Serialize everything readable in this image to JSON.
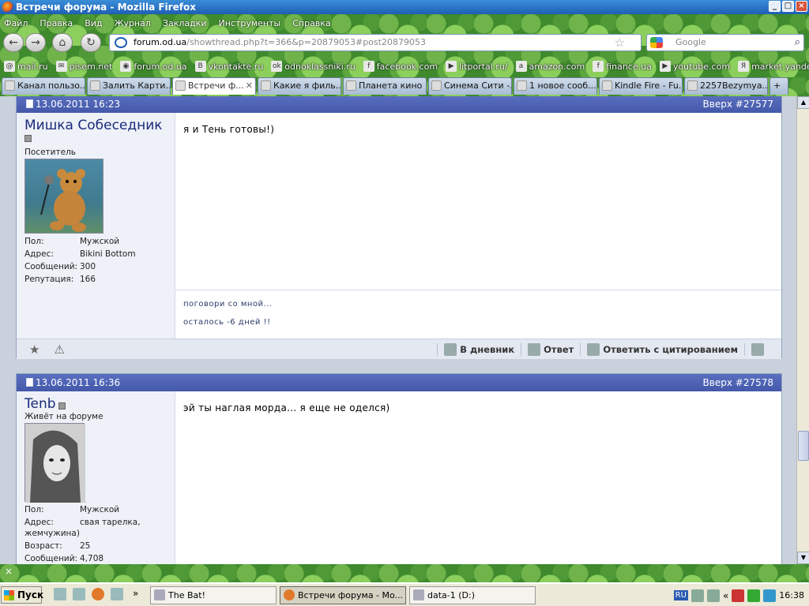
{
  "window": {
    "title": "Встречи форума - Mozilla Firefox"
  },
  "menu": [
    "Файл",
    "Правка",
    "Вид",
    "Журнал",
    "Закладки",
    "Инструменты",
    "Справка"
  ],
  "address": {
    "domain": "forum.od.ua",
    "path": "/showthread.php?t=366&p=20879053#post20879053"
  },
  "search": {
    "placeholder": "Google"
  },
  "bookmarks": [
    {
      "label": "mail.ru",
      "icon": "@"
    },
    {
      "label": "pisem.net",
      "icon": "✉"
    },
    {
      "label": "forum.od.ua",
      "icon": "◉"
    },
    {
      "label": "vkontakte.ru",
      "icon": "В"
    },
    {
      "label": "odnoklassniki.ru",
      "icon": "ok"
    },
    {
      "label": "facebook.com",
      "icon": "f"
    },
    {
      "label": "litportal.ru/",
      "icon": "▶"
    },
    {
      "label": "amazon.com",
      "icon": "a"
    },
    {
      "label": "finance.ua",
      "icon": "f"
    },
    {
      "label": "youtube.com",
      "icon": "▶"
    },
    {
      "label": "market.yandex.ua",
      "icon": "Я"
    }
  ],
  "tabs": [
    {
      "label": "Канал пользо...",
      "active": false
    },
    {
      "label": "Залить Карти...",
      "active": false
    },
    {
      "label": "Встречи ф...",
      "active": true
    },
    {
      "label": "Какие я филь...",
      "active": false
    },
    {
      "label": "Планета кино",
      "active": false
    },
    {
      "label": "Синема Сити -...",
      "active": false
    },
    {
      "label": "1 новое сооб...",
      "active": false
    },
    {
      "label": "Kindle Fire - Fu...",
      "active": false
    },
    {
      "label": "2257Bezymya...",
      "active": false
    }
  ],
  "posts": [
    {
      "date": "13.06.2011 16:23",
      "top_link": "Вверх #27577",
      "username": "Мишка Собеседник",
      "user_title": "Посетитель",
      "fields": [
        {
          "k": "Пол:",
          "v": "Мужской"
        },
        {
          "k": "Адрес:",
          "v": "Bikini Bottom"
        },
        {
          "k": "Сообщений:",
          "v": "300"
        },
        {
          "k": "Репутация:",
          "v": "166"
        }
      ],
      "text": "я и Тень готовы!)",
      "signature": [
        "поговори со мной...",
        "осталось -6 дней !!"
      ]
    },
    {
      "date": "13.06.2011 16:36",
      "top_link": "Вверх #27578",
      "username": "Tenb",
      "user_title": "Живёт на форуме",
      "fields": [
        {
          "k": "Пол:",
          "v": "Мужской"
        },
        {
          "k": "Адрес:",
          "v": "свая тарелка,"
        },
        {
          "k": "",
          "v": "жемчужина)"
        },
        {
          "k": "Возраст:",
          "v": "25"
        },
        {
          "k": "Сообщений:",
          "v": "4,708"
        }
      ],
      "text": "эй ты наглая морда... я еще не оделся)"
    }
  ],
  "actions": {
    "diary": "В дневник",
    "reply": "Ответ",
    "quote": "Ответить с цитированием"
  },
  "taskbar": {
    "start": "Пуск",
    "tasks": [
      "The Bat!",
      "Встречи форума - Mo...",
      "data-1 (D:)"
    ],
    "lang": "RU",
    "clock": "16:38"
  }
}
